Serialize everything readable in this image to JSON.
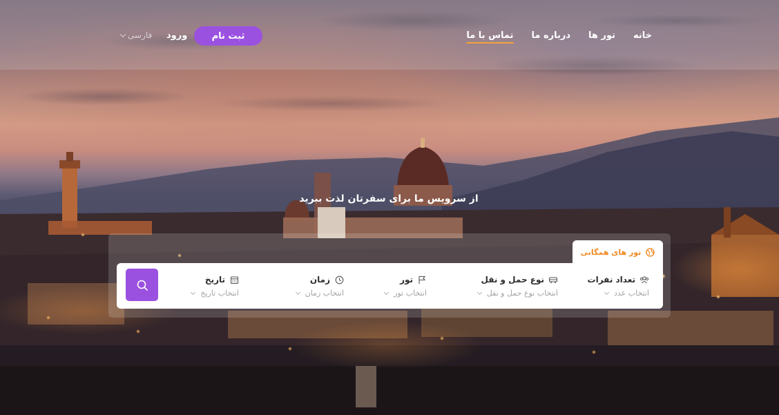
{
  "nav": {
    "links": [
      {
        "label": "خانه",
        "name": "nav-link-home",
        "active": false
      },
      {
        "label": "تور ها",
        "name": "nav-link-tours",
        "active": false
      },
      {
        "label": "درباره ما",
        "name": "nav-link-about",
        "active": false
      },
      {
        "label": "تماس با ما",
        "name": "nav-link-contact",
        "active": true
      }
    ],
    "signup_label": "ثبت نام",
    "login_label": "ورود",
    "language": "فارسی"
  },
  "hero": {
    "tagline": "از سرویس ما برای سفرتان لذت ببرید"
  },
  "search": {
    "tab_label": "تور های همگانی",
    "tab_icon": "globe-icon",
    "fields": [
      {
        "name": "passengers",
        "label": "تعداد نفرات",
        "placeholder": "انتخاب عدد",
        "icon": "users-icon"
      },
      {
        "name": "transport",
        "label": "نوع حمل و نقل",
        "placeholder": "انتخاب نوع حمل و نقل",
        "icon": "car-icon"
      },
      {
        "name": "tour",
        "label": "تور",
        "placeholder": "انتخاب تور",
        "icon": "flag-icon"
      },
      {
        "name": "time",
        "label": "زمان",
        "placeholder": "انتخاب زمان",
        "icon": "clock-icon"
      },
      {
        "name": "date",
        "label": "تاریخ",
        "placeholder": "انتخاب تاریخ",
        "icon": "calendar-icon"
      }
    ],
    "button_icon": "search-icon"
  },
  "colors": {
    "accent": "#9b51e0",
    "tab_text": "#f08a24",
    "nav_underline": "#f3a33a"
  }
}
